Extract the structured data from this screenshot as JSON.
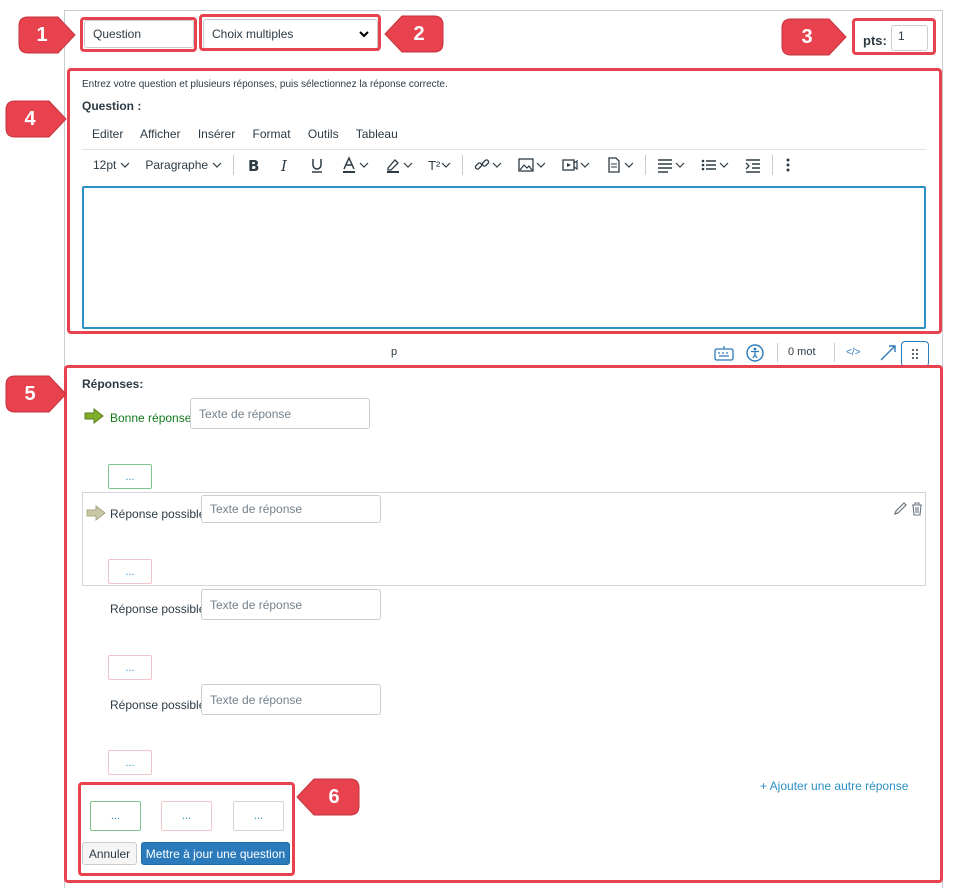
{
  "question_name": "Question",
  "question_type": {
    "selected": "Choix multiples"
  },
  "points": {
    "label": "pts:",
    "value": "1"
  },
  "instructions": "Entrez votre question et plusieurs réponses, puis sélectionnez la réponse correcte.",
  "question_label": "Question :",
  "menu": [
    "Editer",
    "Afficher",
    "Insérer",
    "Format",
    "Outils",
    "Tableau"
  ],
  "toolbar": {
    "font_size": "12pt",
    "block_format": "Paragraphe",
    "superscript": "T²"
  },
  "status_bar": {
    "path": "p",
    "word_count": "0 mot",
    "html_toggle": "</>"
  },
  "answers_label": "Réponses:",
  "answers": [
    {
      "label": "Bonne réponse",
      "placeholder": "Texte de réponse",
      "correct": true
    },
    {
      "label": "Réponse possible",
      "placeholder": "Texte de réponse",
      "correct": false
    },
    {
      "label": "Réponse possible",
      "placeholder": "Texte de réponse",
      "correct": false
    },
    {
      "label": "Réponse possible",
      "placeholder": "Texte de réponse",
      "correct": false
    }
  ],
  "comment_placeholder": "...",
  "add_answer": "+ Ajouter une autre réponse",
  "cancel_label": "Annuler",
  "update_label": "Mettre à jour une question",
  "badges": [
    "1",
    "2",
    "3",
    "4",
    "5",
    "6"
  ],
  "colors": {
    "callout_red": "#e8424e",
    "correct_green": "#127a1b",
    "link_blue": "#2d8fc4",
    "primary_blue": "#2b7abc"
  }
}
